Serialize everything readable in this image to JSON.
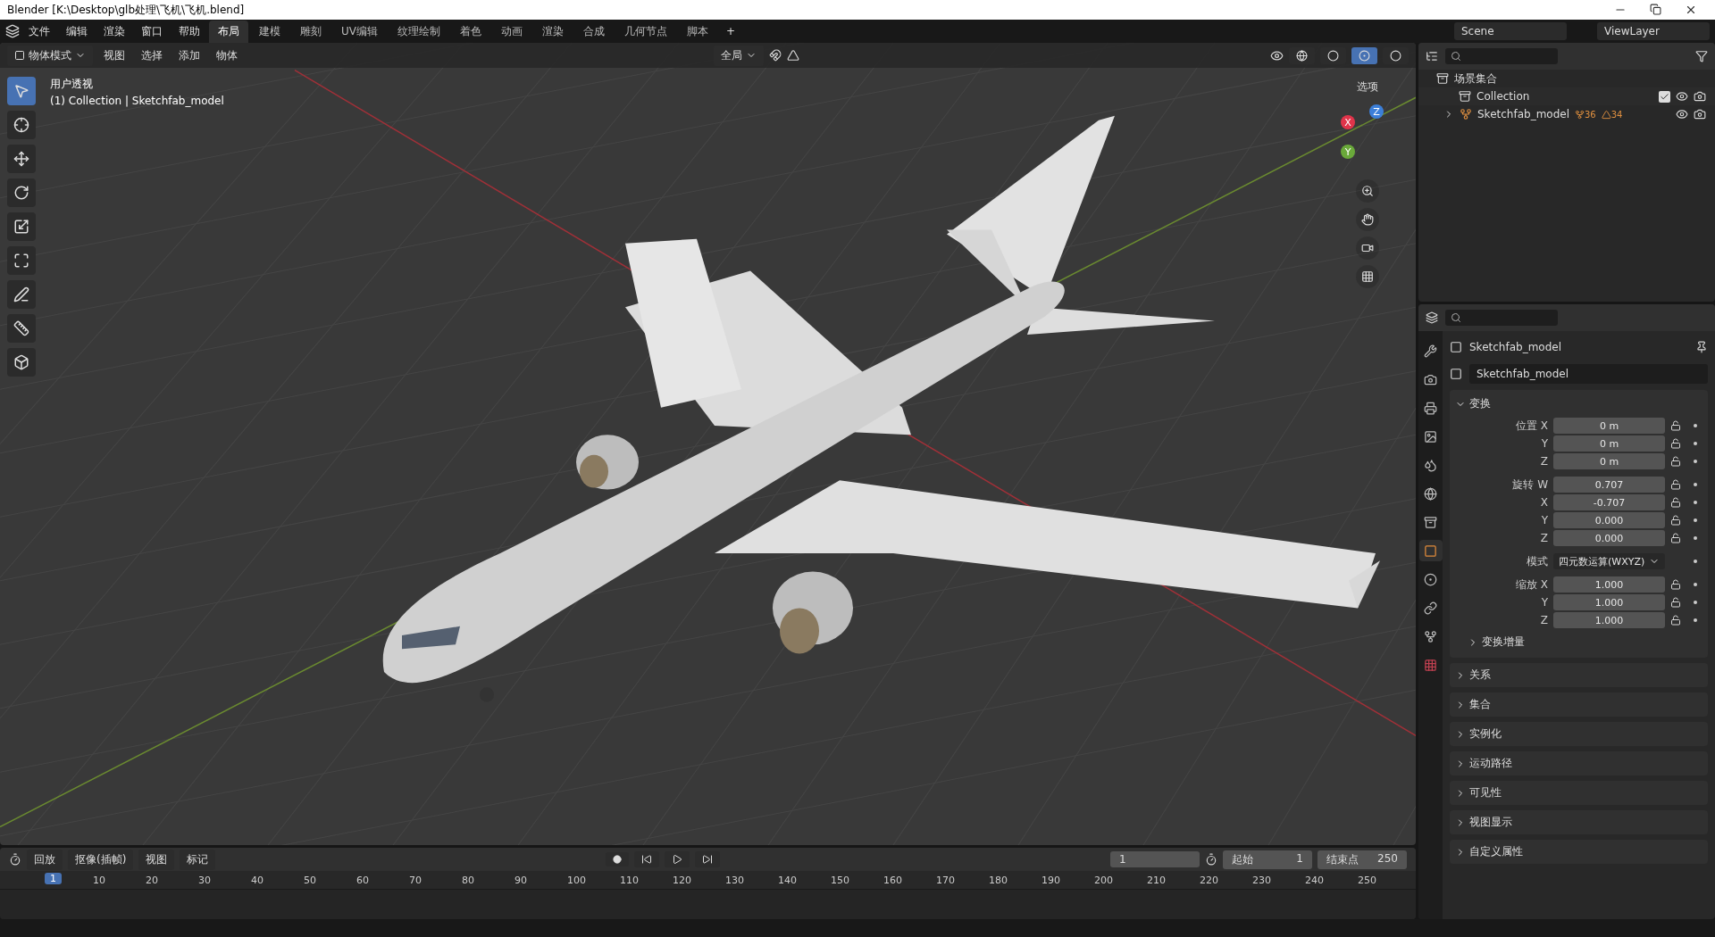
{
  "window": {
    "title": "Blender [K:\\Desktop\\glb处理\\飞机\\飞机.blend]"
  },
  "menu": [
    "文件",
    "编辑",
    "渲染",
    "窗口",
    "帮助"
  ],
  "workspaces": [
    {
      "label": "布局",
      "selected": true
    },
    {
      "label": "建模",
      "selected": false
    },
    {
      "label": "雕刻",
      "selected": false
    },
    {
      "label": "UV编辑",
      "selected": false
    },
    {
      "label": "纹理绘制",
      "selected": false
    },
    {
      "label": "着色",
      "selected": false
    },
    {
      "label": "动画",
      "selected": false
    },
    {
      "label": "渲染",
      "selected": false
    },
    {
      "label": "合成",
      "selected": false
    },
    {
      "label": "几何节点",
      "selected": false
    },
    {
      "label": "脚本",
      "selected": false
    }
  ],
  "add_tab": "+",
  "scene": "Scene",
  "view_layer": "ViewLayer",
  "viewport_header": {
    "mode": "物体模式",
    "menus": [
      "视图",
      "选择",
      "添加",
      "物体"
    ],
    "orientation": "全局",
    "options": "选项",
    "shading": [
      {
        "selected": false
      },
      {
        "selected": false
      },
      {
        "selected": true
      },
      {
        "selected": false
      }
    ]
  },
  "viewport": {
    "view_name": "用户透视",
    "info": "(1) Collection | Sketchfab_model",
    "gizmo": [
      {
        "label": "X",
        "color": "#e0344a"
      },
      {
        "label": "Y",
        "color": "#6aa93a"
      },
      {
        "label": "Z",
        "color": "#3c7fd8"
      }
    ]
  },
  "tools": [
    {
      "selected": true
    },
    {
      "selected": false
    },
    {
      "selected": false
    },
    {
      "selected": false
    },
    {
      "selected": false
    },
    {
      "selected": false
    },
    {
      "selected": false
    },
    {
      "selected": false
    },
    {
      "selected": false
    }
  ],
  "outliner": {
    "root": "场景集合",
    "items": [
      {
        "kind": "collection",
        "name": "Collection",
        "checked": true
      },
      {
        "kind": "object",
        "name": "Sketchfab_model",
        "expanded": false,
        "counts": [
          "36",
          "34"
        ]
      }
    ]
  },
  "properties": {
    "tabs": [
      {
        "selected": false
      },
      {
        "selected": false
      },
      {
        "selected": false
      },
      {
        "selected": false
      },
      {
        "selected": false
      },
      {
        "selected": false
      },
      {
        "selected": false
      },
      {
        "selected": true
      },
      {
        "selected": false
      },
      {
        "selected": false
      },
      {
        "selected": false
      },
      {
        "selected": false
      }
    ],
    "object_name": "Sketchfab_model",
    "data_name": "Sketchfab_model",
    "transform": {
      "title": "变换",
      "expanded": true,
      "groups": [
        {
          "rows": [
            {
              "label": "位置 X",
              "value": "0 m"
            },
            {
              "label": "Y",
              "value": "0 m"
            },
            {
              "label": "Z",
              "value": "0 m"
            }
          ]
        },
        {
          "rows": [
            {
              "label": "旋转 W",
              "value": "0.707"
            },
            {
              "label": "X",
              "value": "-0.707"
            },
            {
              "label": "Y",
              "value": "0.000"
            },
            {
              "label": "Z",
              "value": "0.000"
            }
          ]
        },
        {
          "rows": [
            {
              "label": "模式",
              "value": "四元数运算(WXYZ)",
              "kind": "dropdown"
            }
          ]
        },
        {
          "rows": [
            {
              "label": "缩放 X",
              "value": "1.000"
            },
            {
              "label": "Y",
              "value": "1.000"
            },
            {
              "label": "Z",
              "value": "1.000"
            }
          ]
        }
      ],
      "delta": "变换增量"
    },
    "panels": [
      {
        "title": "关系",
        "expanded": false
      },
      {
        "title": "集合",
        "expanded": false
      },
      {
        "title": "实例化",
        "expanded": false
      },
      {
        "title": "运动路径",
        "expanded": false
      },
      {
        "title": "可见性",
        "expanded": false
      },
      {
        "title": "视图显示",
        "expanded": false
      },
      {
        "title": "自定义属性",
        "expanded": false
      }
    ]
  },
  "timeline": {
    "menus": [
      "回放",
      "抠像(插帧)",
      "视图",
      "标记"
    ],
    "current_frame": "1",
    "start_label": "起始",
    "start": "1",
    "end_label": "结束点",
    "end": "250",
    "ticks": [
      "10",
      "20",
      "30",
      "40",
      "50",
      "60",
      "70",
      "80",
      "90",
      "100",
      "110",
      "120",
      "130",
      "140",
      "150",
      "160",
      "170",
      "180",
      "190",
      "200",
      "210",
      "220",
      "230",
      "240",
      "250"
    ],
    "playhead": "1"
  }
}
